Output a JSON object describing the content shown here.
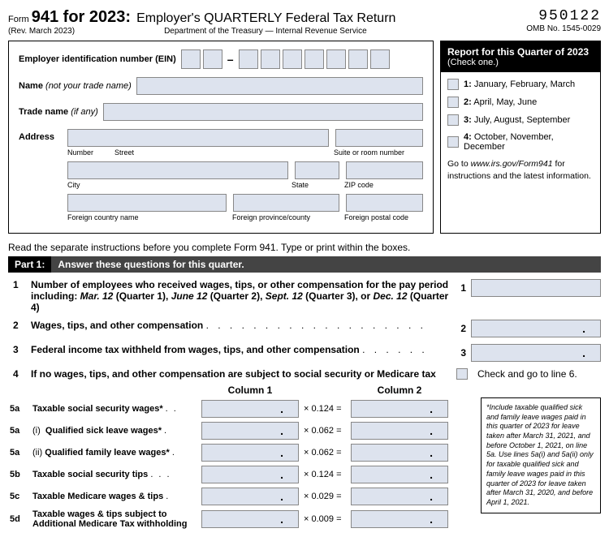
{
  "header": {
    "form_word": "Form",
    "form_number": "941 for 2023:",
    "title": "Employer's QUARTERLY Federal Tax Return",
    "revision": "(Rev. March 2023)",
    "department": "Department of the Treasury — Internal Revenue Service",
    "code": "950122",
    "omb": "OMB No. 1545-0029"
  },
  "employer": {
    "ein_label": "Employer identification number (EIN)",
    "name_label_b": "Name",
    "name_label_i": " (not your trade name)",
    "trade_label_b": "Trade name",
    "trade_label_i": " (if any)",
    "address_label": "Address",
    "sublabels": {
      "number": "Number",
      "street": "Street",
      "suite": "Suite or room number",
      "city": "City",
      "state": "State",
      "zip": "ZIP code",
      "fcountry": "Foreign country name",
      "fprovince": "Foreign province/county",
      "fpostal": "Foreign postal code"
    }
  },
  "quarter": {
    "title": "Report for this Quarter of 2023",
    "subtitle": "(Check one.)",
    "options": [
      {
        "num": "1:",
        "text": "January, February, March"
      },
      {
        "num": "2:",
        "text": "April, May, June"
      },
      {
        "num": "3:",
        "text": "July, August, September"
      },
      {
        "num": "4:",
        "text": "October, November, December"
      }
    ],
    "link_pre": "Go to ",
    "link_url": "www.irs.gov/Form941",
    "link_post": " for instructions and the latest information."
  },
  "instructions": "Read the separate instructions before you complete Form 941. Type or print within the boxes.",
  "part1": {
    "label": "Part 1:",
    "text": "Answer these questions for this quarter."
  },
  "lines": {
    "l1": {
      "num": "1",
      "text_a": "Number of employees who received wages, tips, or other compensation for the pay period",
      "text_b_pre": "including: ",
      "text_b_1": "Mar. 12",
      "text_b_2": " (Quarter 1), ",
      "text_b_3": "June 12",
      "text_b_4": " (Quarter 2), ",
      "text_b_5": "Sept. 12",
      "text_b_6": " (Quarter 3), or ",
      "text_b_7": "Dec. 12",
      "text_b_8": " (Quarter 4)",
      "rnum": "1"
    },
    "l2": {
      "num": "2",
      "text": "Wages, tips, and other compensation",
      "rnum": "2"
    },
    "l3": {
      "num": "3",
      "text": "Federal income tax withheld from wages, tips, and other compensation",
      "rnum": "3"
    },
    "l4": {
      "num": "4",
      "text": "If no wages, tips, and other compensation are subject to social security or Medicare tax",
      "check": "Check and go to line 6."
    },
    "col1": "Column 1",
    "col2": "Column 2",
    "l5a": {
      "num": "5a",
      "text": "Taxable social security wages*",
      "mult": "× 0.124 ="
    },
    "l5ai": {
      "num": "5a",
      "sub": "(i)",
      "text": "Qualified sick leave wages*",
      "mult": "× 0.062 ="
    },
    "l5aii": {
      "num": "5a",
      "sub": "(ii)",
      "text": "Qualified family leave wages*",
      "mult": "× 0.062 ="
    },
    "l5b": {
      "num": "5b",
      "text": "Taxable social security tips",
      "mult": "× 0.124 ="
    },
    "l5c": {
      "num": "5c",
      "text": "Taxable Medicare wages & tips",
      "mult": "× 0.029 ="
    },
    "l5d": {
      "num": "5d",
      "text_a": "Taxable wages & tips subject to",
      "text_b": "Additional Medicare Tax withholding",
      "mult": "× 0.009 ="
    }
  },
  "footnote": "*Include taxable qualified sick and family leave wages paid in this quarter of 2023 for leave taken after March 31, 2021, and before October 1, 2021, on line 5a. Use lines 5a(i) and 5a(ii) only for taxable qualified sick and family leave wages paid in this quarter of 2023 for leave taken after March 31, 2020, and before April 1, 2021."
}
